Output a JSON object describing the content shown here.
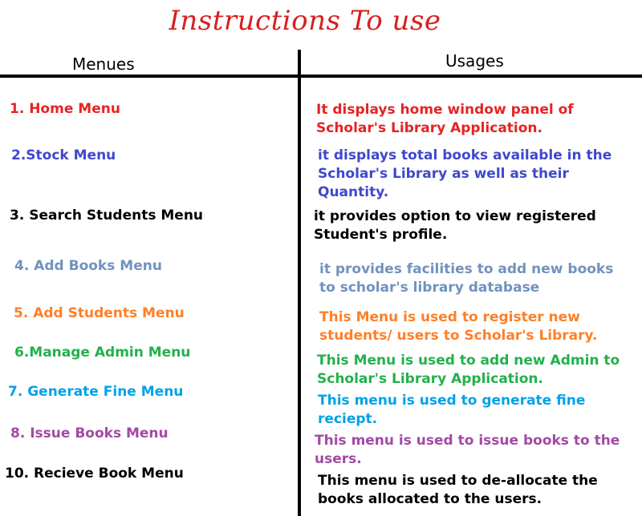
{
  "title": "Instructions To use",
  "headers": {
    "menus": "Menues",
    "usages": "Usages"
  },
  "rows": [
    {
      "menu": "1. Home Menu",
      "usage": "It displays home window panel of Scholar's Library Application.",
      "color": "#e52424"
    },
    {
      "menu": "2.Stock Menu",
      "usage": "it displays total books available in the Scholar's Library as well as their Quantity.",
      "color": "#3f48cc"
    },
    {
      "menu": "3. Search Students Menu",
      "usage": "it provides option to view registered Student's profile.",
      "color": "#000000"
    },
    {
      "menu": "4. Add Books Menu",
      "usage": "it provides facilities to add new books to scholar's library database",
      "color": "#7092be"
    },
    {
      "menu": "5. Add Students Menu",
      "usage": "This Menu is used to register new students/ users to Scholar's Library.",
      "color": "#ff7f27"
    },
    {
      "menu": "6.Manage Admin Menu",
      "usage": "This Menu is used to add new Admin to Scholar's Library Application.",
      "color": "#22b14c"
    },
    {
      "menu": "7. Generate Fine Menu",
      "usage": "This menu is used to  generate fine reciept.",
      "color": "#00a2e8"
    },
    {
      "menu": "8. Issue Books Menu",
      "usage": "This menu is used to issue books to the users.",
      "color": "#a349a4"
    },
    {
      "menu": "10. Recieve Book Menu",
      "usage": "This menu is used to de-allocate the books allocated to the users.",
      "color": "#000000"
    }
  ]
}
